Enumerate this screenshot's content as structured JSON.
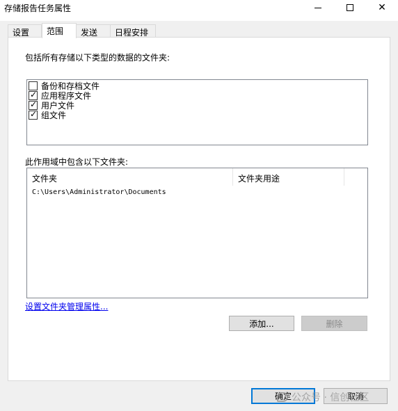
{
  "window": {
    "title": "存储报告任务属性"
  },
  "tabs": [
    {
      "label": "设置",
      "active": false
    },
    {
      "label": "范围",
      "active": true
    },
    {
      "label": "发送",
      "active": false
    },
    {
      "label": "日程安排",
      "active": false
    }
  ],
  "scope": {
    "types_label": "包括所有存储以下类型的数据的文件夹:",
    "types": [
      {
        "label": "备份和存档文件",
        "checked": false
      },
      {
        "label": "应用程序文件",
        "checked": true
      },
      {
        "label": "用户文件",
        "checked": true
      },
      {
        "label": "组文件",
        "checked": true
      }
    ],
    "folders_label": "此作用域中包含以下文件夹:",
    "columns": [
      "文件夹",
      "文件夹用途"
    ],
    "rows": [
      {
        "folder": "C:\\Users\\Administrator\\Documents",
        "usage": ""
      }
    ],
    "link_label": "设置文件夹管理属性...",
    "add_label": "添加...",
    "delete_label": "删除"
  },
  "footer": {
    "ok_label": "确定",
    "cancel_label": "取消"
  },
  "watermark": {
    "text": "公众号 · 信创社区"
  },
  "icons": {
    "minimize": "minimize-icon",
    "maximize": "maximize-icon",
    "close": "close-icon",
    "check": "check-icon"
  },
  "colors": {
    "accent": "#0078d7",
    "link": "#0000ee"
  }
}
